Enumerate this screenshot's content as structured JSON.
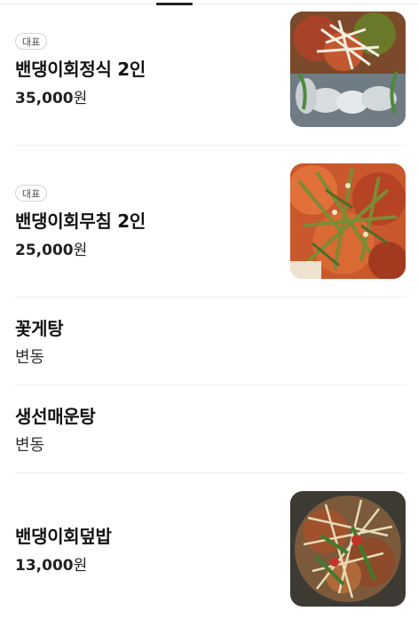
{
  "menu": {
    "items": [
      {
        "badge": "대표",
        "name": "밴댕이회정식 2인",
        "price": "35,000",
        "currency": "원",
        "image": "sashimi-set-photo"
      },
      {
        "badge": "대표",
        "name": "밴댕이회무침 2인",
        "price": "25,000",
        "currency": "원",
        "image": "spicy-sashimi-salad-photo"
      },
      {
        "name": "꽃게탕",
        "price_text": "변동"
      },
      {
        "name": "생선매운탕",
        "price_text": "변동"
      },
      {
        "name": "밴댕이회덮밥",
        "price": "13,000",
        "currency": "원",
        "image": "sashimi-rice-bowl-photo"
      }
    ]
  },
  "colors": {
    "divider": "#efefef",
    "badge_border": "#d5d5d5",
    "text": "#141414"
  }
}
